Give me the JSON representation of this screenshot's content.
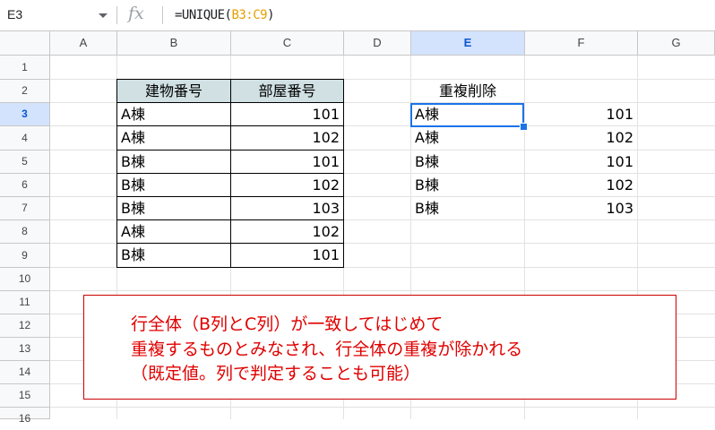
{
  "formula_bar": {
    "name_box": "E3",
    "fx_label": "fx",
    "formula_prefix": "=UNIQUE(",
    "formula_range": "B3:C9",
    "formula_suffix": ")"
  },
  "columns": [
    "A",
    "B",
    "C",
    "D",
    "E",
    "F",
    "G"
  ],
  "rows": [
    "1",
    "2",
    "3",
    "4",
    "5",
    "6",
    "7",
    "8",
    "9",
    "10",
    "11",
    "12",
    "13",
    "14",
    "15",
    "16"
  ],
  "table": {
    "headers": [
      "建物番号",
      "部屋番号"
    ],
    "rows": [
      [
        "A棟",
        "101"
      ],
      [
        "A棟",
        "102"
      ],
      [
        "B棟",
        "101"
      ],
      [
        "B棟",
        "102"
      ],
      [
        "B棟",
        "103"
      ],
      [
        "A棟",
        "102"
      ],
      [
        "B棟",
        "101"
      ]
    ]
  },
  "result": {
    "title": "重複削除",
    "rows": [
      [
        "A棟",
        "101"
      ],
      [
        "A棟",
        "102"
      ],
      [
        "B棟",
        "101"
      ],
      [
        "B棟",
        "102"
      ],
      [
        "B棟",
        "103"
      ]
    ]
  },
  "note": {
    "lines": [
      "行全体（B列とC列）が一致してはじめて",
      "重複するものとみなされ、行全体の重複が除かれる",
      "（既定値。列で判定することも可能）"
    ]
  },
  "colors": {
    "header_fill": "#d0e0e3",
    "selection": "#1a73e8",
    "note_text": "#e00000",
    "formula_range": "#e69f00"
  }
}
